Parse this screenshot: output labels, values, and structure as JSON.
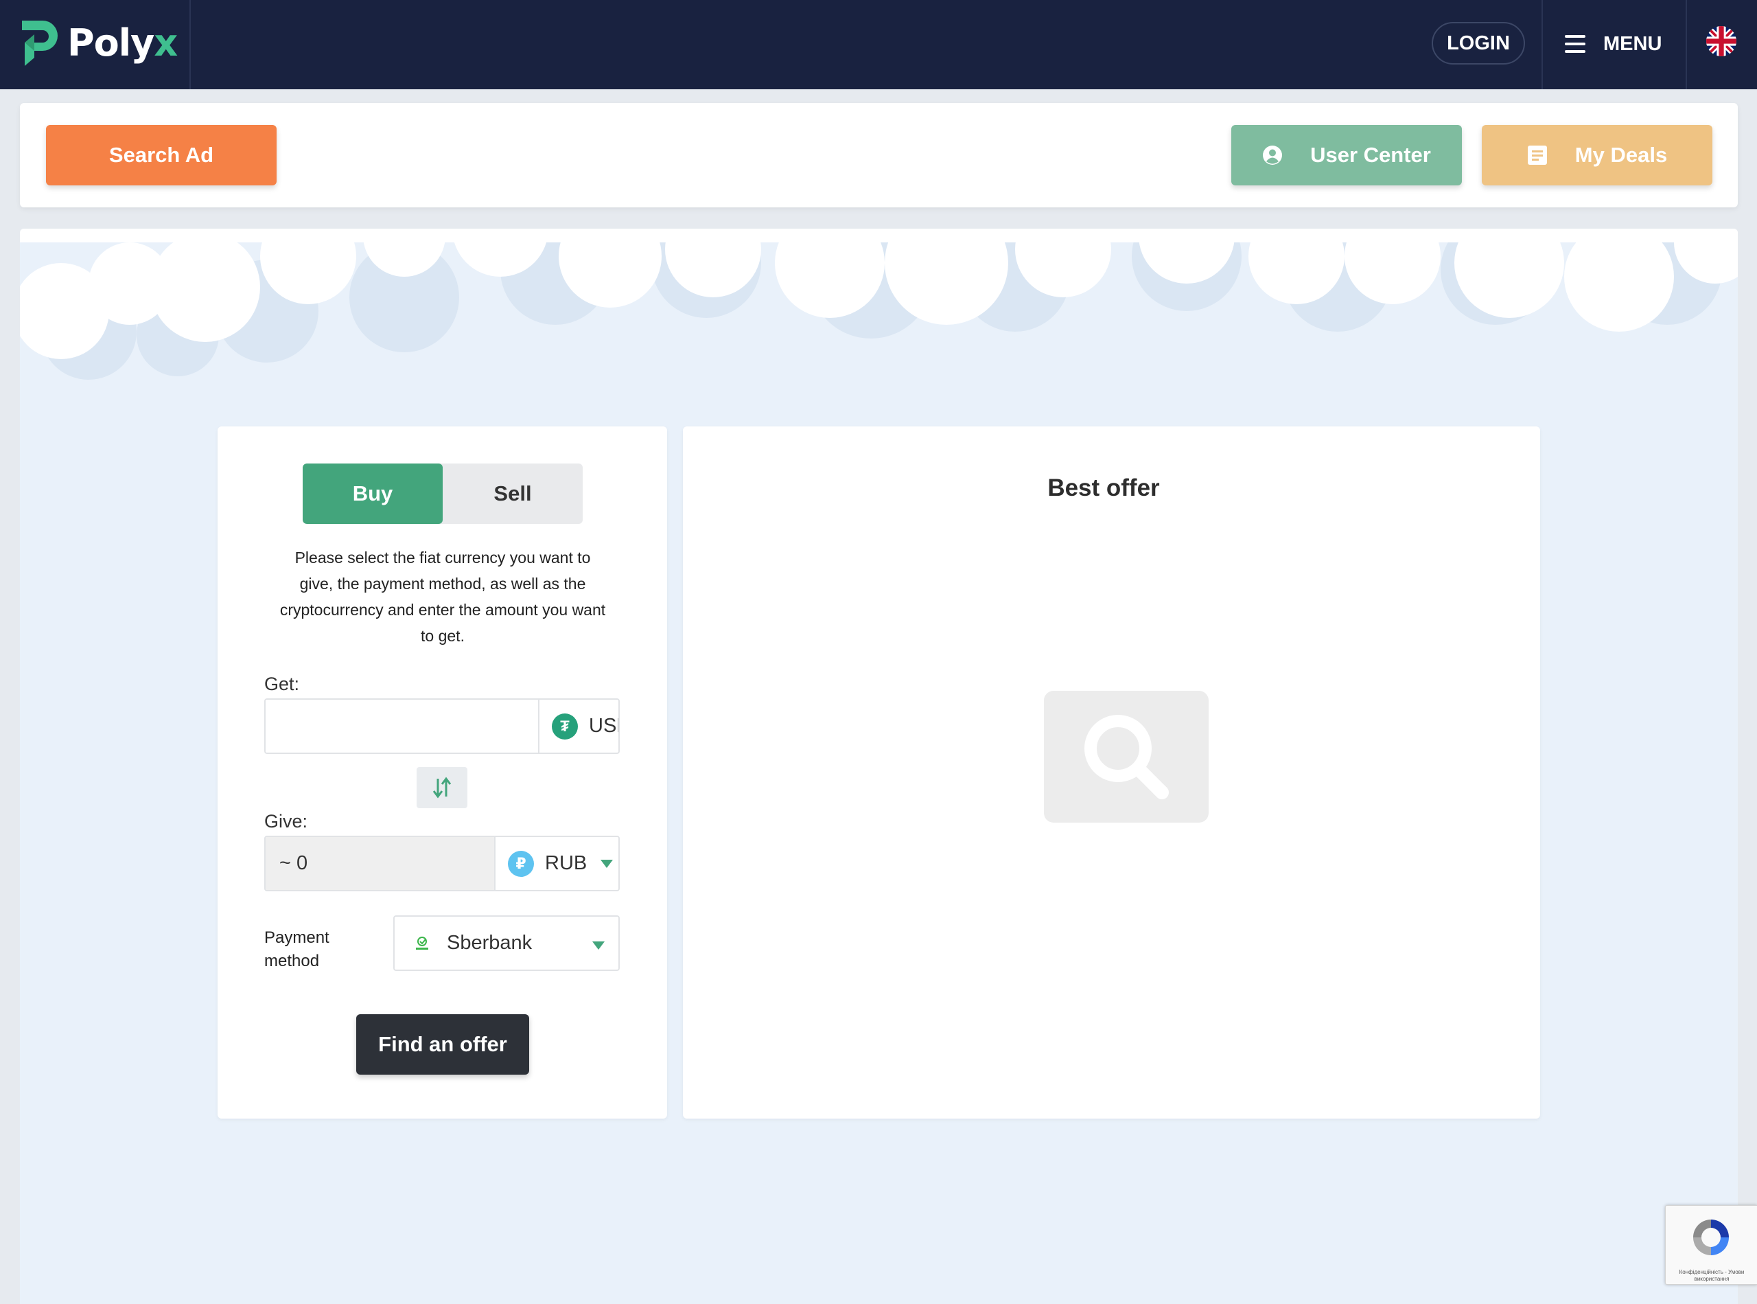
{
  "header": {
    "logo_main": "Poly",
    "logo_accent": "x",
    "login_label": "LOGIN",
    "menu_label": "MENU",
    "language_icon": "uk-flag-icon"
  },
  "actions": {
    "search_ad": "Search Ad",
    "user_center": "User Center",
    "my_deals": "My Deals"
  },
  "exchange_form": {
    "tab_buy": "Buy",
    "tab_sell": "Sell",
    "active_tab": "Buy",
    "description": "Please select the fiat currency you want to give, the payment method, as well as the cryptocurrency and enter the amount you want to get.",
    "get_label": "Get:",
    "get_value": "",
    "get_currency": "USDT",
    "get_currency_symbol": "₮",
    "give_label": "Give:",
    "give_value": "~ 0",
    "give_currency": "RUB",
    "give_currency_symbol": "₽",
    "payment_method_label": "Payment method",
    "payment_method_value": "Sberbank",
    "submit_label": "Find an offer"
  },
  "best_offer": {
    "title": "Best offer"
  },
  "recaptcha": {
    "footer_text": "Конфіденційність - Умови використання"
  },
  "colors": {
    "nav_bg": "#192240",
    "accent_green": "#43a57c",
    "search_orange": "#f58146",
    "user_center_green": "#7fbc9f",
    "my_deals_tan": "#efc383",
    "usdt_green": "#26a17b",
    "rub_blue": "#5ec3f0"
  }
}
